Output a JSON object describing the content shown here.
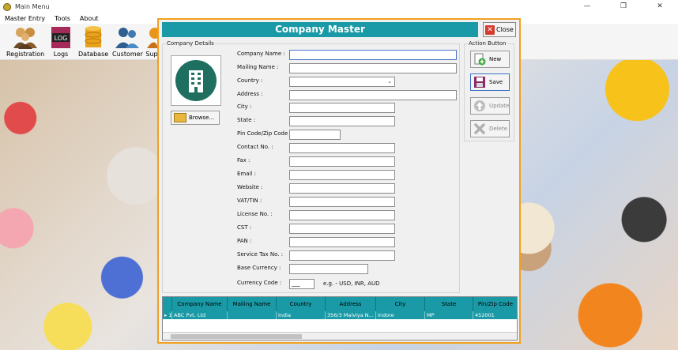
{
  "window": {
    "title": "Main Menu",
    "minimize": "—",
    "restore": "❐",
    "close": "✕"
  },
  "menu": [
    "Master Entry",
    "Tools",
    "About"
  ],
  "toolbar": [
    {
      "label": "Registration",
      "icon": "people-icon"
    },
    {
      "label": "Logs",
      "icon": "log-book-icon",
      "badge": "LOG"
    },
    {
      "label": "Database",
      "icon": "database-icon"
    },
    {
      "label": "Customer",
      "icon": "customer-icon"
    },
    {
      "label": "Sup",
      "icon": "supplier-icon"
    }
  ],
  "dialog": {
    "title": "Company Master",
    "close_label": "Close",
    "details_group": "Company Details",
    "browse_label": "Browse...",
    "fields": {
      "company_name": "Company Name :",
      "mailing_name": "Mailing Name :",
      "country": "Country :",
      "address": "Address :",
      "city": "City :",
      "state": "State :",
      "pin": "Pin Code/Zip Code :",
      "contact": "Contact No. :",
      "fax": "Fax :",
      "email": "Email :",
      "website": "Website :",
      "vat": "VAT/TIN :",
      "license": "License No. :",
      "cst": "CST :",
      "pan": "PAN :",
      "service_tax": "Service Tax No. :",
      "base_currency": "Base Currency :",
      "currency_code": "Currency Code :"
    },
    "currency_code_value": "___",
    "currency_hint": "e.g. - USD, INR, AUD",
    "action_group": "Action Button",
    "actions": {
      "new": "New",
      "save": "Save",
      "update": "Update",
      "delete": "Delete"
    }
  },
  "grid": {
    "columns": [
      "Company Name",
      "Mailing Name",
      "Country",
      "Address",
      "City",
      "State",
      "Pin/Zip Code"
    ],
    "rows": [
      {
        "marker": "▸ 1",
        "company": "ABC Pvt. Ltd",
        "mailing": "",
        "country": "India",
        "address": "356/3 Malviya N...",
        "city": "Indore",
        "state": "MP",
        "pin": "452001"
      }
    ]
  },
  "colors": {
    "accent": "#1a9aa6",
    "dialog_border": "#f2a020",
    "close_red": "#d53a2e"
  }
}
